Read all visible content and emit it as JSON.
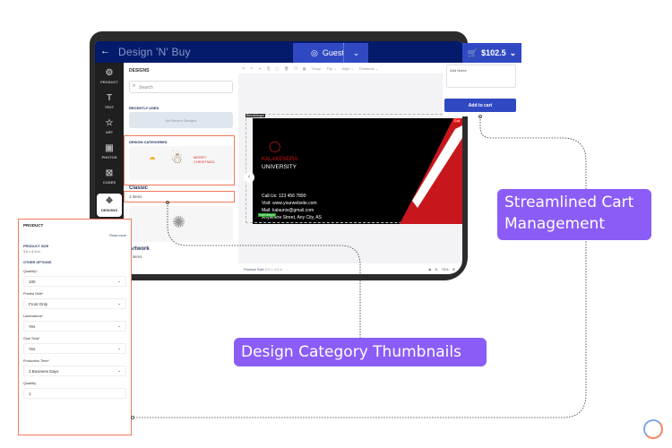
{
  "app": {
    "brand": "Design 'N' Buy",
    "back_icon": "arrow-left-icon"
  },
  "header": {
    "guest_label": "Guest",
    "cart_total": "$102.5"
  },
  "rail": [
    {
      "label": "PRODUCT",
      "icon": "⚙"
    },
    {
      "label": "TEXT",
      "icon": "T"
    },
    {
      "label": "ART",
      "icon": "☆"
    },
    {
      "label": "PHOTOS",
      "icon": "▣"
    },
    {
      "label": "CODES",
      "icon": "⊠"
    },
    {
      "label": "DESIGNS",
      "icon": "❖"
    }
  ],
  "designs_panel": {
    "title": "DESIGNS",
    "search_placeholder": "Search",
    "recently_used_label": "RECENTLY USED",
    "no_recent": "No Recent Designs",
    "categories_label": "DESIGN CATEGORIES",
    "categories": [
      {
        "name": "Classic",
        "count": "3 items"
      },
      {
        "name": "Artwork",
        "count": "3 items"
      }
    ]
  },
  "toolbar": {
    "items": [
      "Group",
      "Flip ⌄",
      "Align ⌄",
      "Distribute ⌄"
    ]
  },
  "card": {
    "bleed_label": "BleedMargin",
    "safe_label": "SafeMargin",
    "cut_label": "Cut",
    "org_line1": "KALAKENDRA",
    "org_line2": "UNIVERSITY",
    "call": "Call Us: 123 456 7890",
    "visit": "Visit: www.yourwebsite.com",
    "mail": "Mail: kalauniv@gmail.com",
    "address": "Anywhere Street, Any City, AS"
  },
  "bottombar": {
    "size_label": "Product Size",
    "size_value": "9.5 x 4.5 in",
    "zoom": "75%"
  },
  "notes": {
    "placeholder": "Add Notes",
    "add_to_cart": "Add to cart"
  },
  "product_panel": {
    "title": "PRODUCT",
    "read_more": "Read more",
    "size_label": "PRODUCT SIZE",
    "size_value": "9.5 x 4.5 in",
    "other_options": "OTHER OPTIONS",
    "fields": [
      {
        "label": "Quantity",
        "required": true,
        "value": "100"
      },
      {
        "label": "Printed Side",
        "required": true,
        "value": "Front Only"
      },
      {
        "label": "Laminations",
        "required": true,
        "value": "Yes"
      },
      {
        "label": "Glue Strip",
        "required": true,
        "value": "Yes"
      },
      {
        "label": "Production Time",
        "required": true,
        "value": "2 Business Days"
      }
    ],
    "quantity_label": "Quantity",
    "quantity_value": "1"
  },
  "callouts": {
    "cart": "Streamlined Cart Management",
    "thumbs": "Design Category Thumbnails"
  },
  "colors": {
    "accent": "#3049c3",
    "navy": "#041a6b",
    "callout": "#8b5cf6",
    "highlight": "#f0785a"
  }
}
